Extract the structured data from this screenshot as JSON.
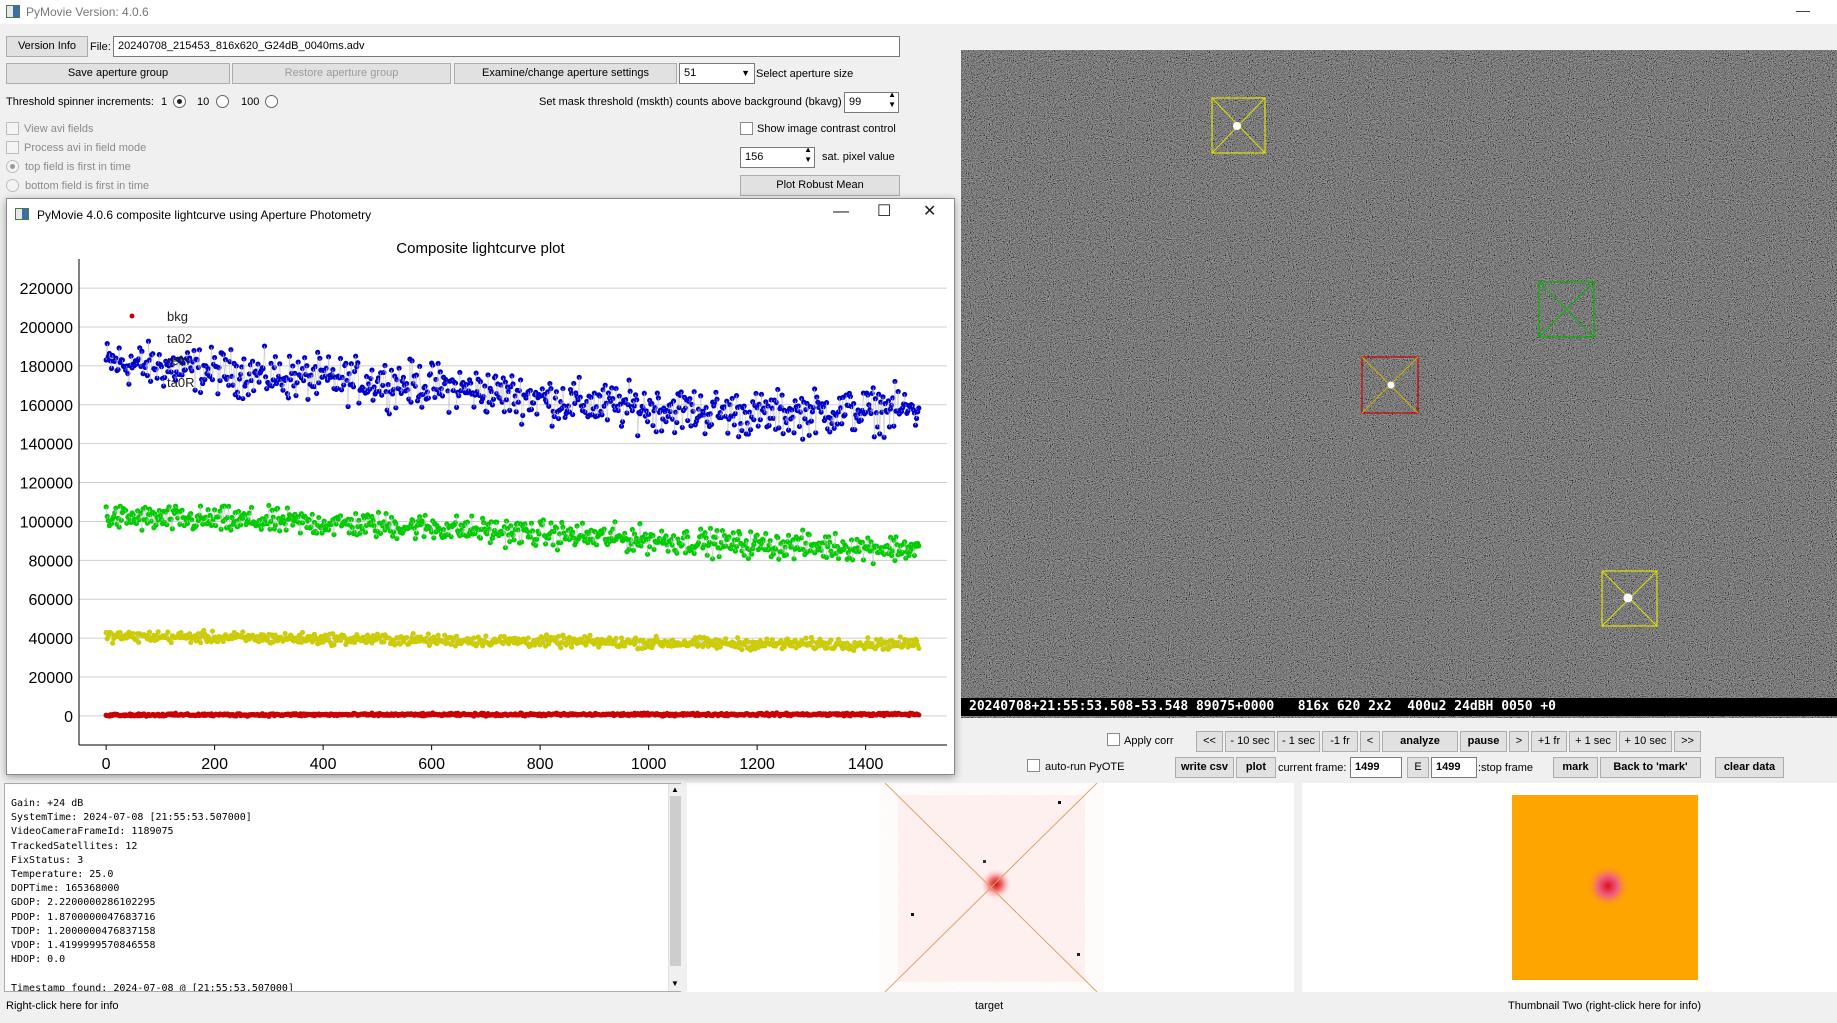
{
  "window": {
    "title": "PyMovie  Version: 4.0.6",
    "minimize": "—"
  },
  "controls": {
    "version_info_btn": "Version Info",
    "file_label": "File:",
    "file_value": "20240708_215453_816x620_G24dB_0040ms.adv",
    "save_aperture_group": "Save aperture group",
    "restore_aperture_group": "Restore aperture group",
    "examine_aperture_settings": "Examine/change aperture settings",
    "aperture_size_value": "51",
    "select_aperture_size_label": "Select aperture size",
    "threshold_spinner_label": "Threshold spinner increments:",
    "threshold_options": [
      {
        "label": "1",
        "selected": true
      },
      {
        "label": "10",
        "selected": false
      },
      {
        "label": "100",
        "selected": false
      }
    ],
    "mask_threshold_label": "Set mask threshold (mskth) counts above background (bkavg)",
    "mask_threshold_value": "99",
    "view_avi_fields": "View avi fields",
    "process_avi_field_mode": "Process avi in field mode",
    "top_field_first": "top field is first in time",
    "bottom_field_first": "bottom field is first in time",
    "show_contrast_control": "Show image contrast control",
    "sat_pixel_value": "156",
    "sat_pixel_label": "sat. pixel value",
    "plot_robust_mean": "Plot Robust Mean"
  },
  "plot_window": {
    "title": "PyMovie 4.0.6 composite lightcurve using Aperture Photometry",
    "chart_title": "Composite lightcurve plot",
    "legend": [
      "bkg",
      "ta02",
      "refn",
      "ta0R"
    ],
    "colors": {
      "blue": "#0000cc",
      "green": "#00cc00",
      "yellow": "#cccc00",
      "red": "#cc0000"
    }
  },
  "chart_data": {
    "type": "scatter",
    "title": "Composite lightcurve plot",
    "xlim": [
      -50,
      1550
    ],
    "ylim": [
      -15000,
      235000
    ],
    "x_ticks": [
      0,
      200,
      400,
      600,
      800,
      1000,
      1200,
      1400
    ],
    "y_ticks": [
      0,
      20000,
      40000,
      60000,
      80000,
      100000,
      120000,
      140000,
      160000,
      180000,
      200000,
      220000
    ],
    "x_tick_labels": [
      "0",
      "200",
      "400",
      "600",
      "800",
      "1000",
      "1200",
      "1400"
    ],
    "y_tick_labels": [
      "0",
      "20000",
      "40000",
      "60000",
      "80000",
      "100000",
      "120000",
      "140000",
      "160000",
      "180000",
      "200000",
      "220000"
    ],
    "frames": [
      0,
      1500
    ],
    "series": [
      {
        "color": "#0000cc",
        "trend": [
          [
            0,
            182000
          ],
          [
            300,
            175000
          ],
          [
            600,
            170000
          ],
          [
            900,
            160000
          ],
          [
            1200,
            155000
          ],
          [
            1500,
            158000
          ]
        ],
        "spread": 12000
      },
      {
        "color": "#00cc00",
        "trend": [
          [
            0,
            102000
          ],
          [
            300,
            100000
          ],
          [
            600,
            97000
          ],
          [
            900,
            92000
          ],
          [
            1200,
            88000
          ],
          [
            1500,
            86000
          ]
        ],
        "spread": 7000
      },
      {
        "color": "#cccc00",
        "trend": [
          [
            0,
            41000
          ],
          [
            300,
            40000
          ],
          [
            600,
            39000
          ],
          [
            900,
            38000
          ],
          [
            1200,
            37000
          ],
          [
            1500,
            37000
          ]
        ],
        "spread": 3000
      },
      {
        "color": "#cc0000",
        "trend": [
          [
            0,
            500
          ],
          [
            1500,
            800
          ]
        ],
        "spread": 700
      }
    ]
  },
  "video": {
    "overlay_text": "20240708+21:55:53.508-53.548 89075+0000   816x 620 2x2  400u2 24dBH 0050 +0"
  },
  "playback": {
    "apply_corr": "Apply corr",
    "auto_run_pyote": "auto-run PyOTE",
    "buttons_row1": [
      "<<",
      "- 10 sec",
      "- 1 sec",
      "-1 fr",
      "<",
      "analyze",
      "pause",
      ">",
      "+1 fr",
      "+ 1 sec",
      "+ 10 sec",
      ">>"
    ],
    "write_csv": "write csv",
    "plot": "plot",
    "current_frame_label": "current frame:",
    "current_frame_value": "1499",
    "e_label": "E",
    "stop_frame_value": "1499",
    "stop_frame_label": ":stop frame",
    "mark": "mark",
    "back_to_mark": "Back to 'mark'",
    "clear_data": "clear data"
  },
  "info_lines": "Gain: +24 dB\nSystemTime: 2024-07-08 [21:55:53.507000]\nVideoCameraFrameId: 1189075\nTrackedSatellites: 12\nFixStatus: 3\nTemperature: 25.0\nDOPTime: 165368000\nGDOP: 2.2200000286102295\nPDOP: 1.8700000047683716\nTDOP: 1.2000000476837158\nVDOP: 1.4199999570846558\nHDOP: 0.0\n\nTimestamp found: 2024-07-08 @ [21:55:53.507000]",
  "footer": {
    "right_click_info": "Right-click here for info",
    "target": "target",
    "thumbnail_two": "Thumbnail Two (right-click here for info)"
  }
}
